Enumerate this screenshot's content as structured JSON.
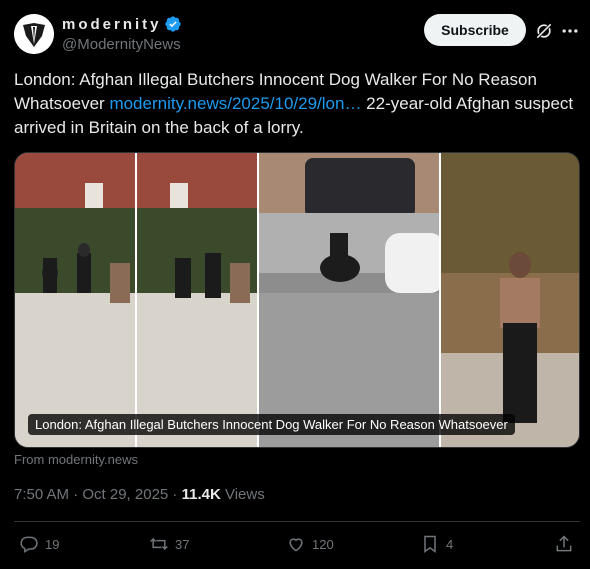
{
  "author": {
    "display_name": "modernity",
    "handle": "@ModernityNews",
    "subscribe_label": "Subscribe"
  },
  "tweet": {
    "text_before": "London: Afghan Illegal Butchers Innocent Dog Walker For No Reason Whatsoever ",
    "link_text": "modernity.news/2025/10/29/lon…",
    "text_after": " 22-year-old Afghan suspect arrived in Britain on the back of a lorry."
  },
  "media": {
    "caption": "London: Afghan Illegal Butchers Innocent Dog Walker For No Reason Whatsoever",
    "source": "From modernity.news"
  },
  "meta": {
    "time": "7:50 AM · Oct 29, 2025 · ",
    "views_count": "11.4K",
    "views_label": " Views"
  },
  "actions": {
    "replies": "19",
    "reposts": "37",
    "likes": "120",
    "bookmarks": "4"
  },
  "colors": {
    "background": "#000000",
    "text": "#e7e9ea",
    "muted": "#71767b",
    "link": "#1d9bf0",
    "verified": "#1d9bf0"
  }
}
